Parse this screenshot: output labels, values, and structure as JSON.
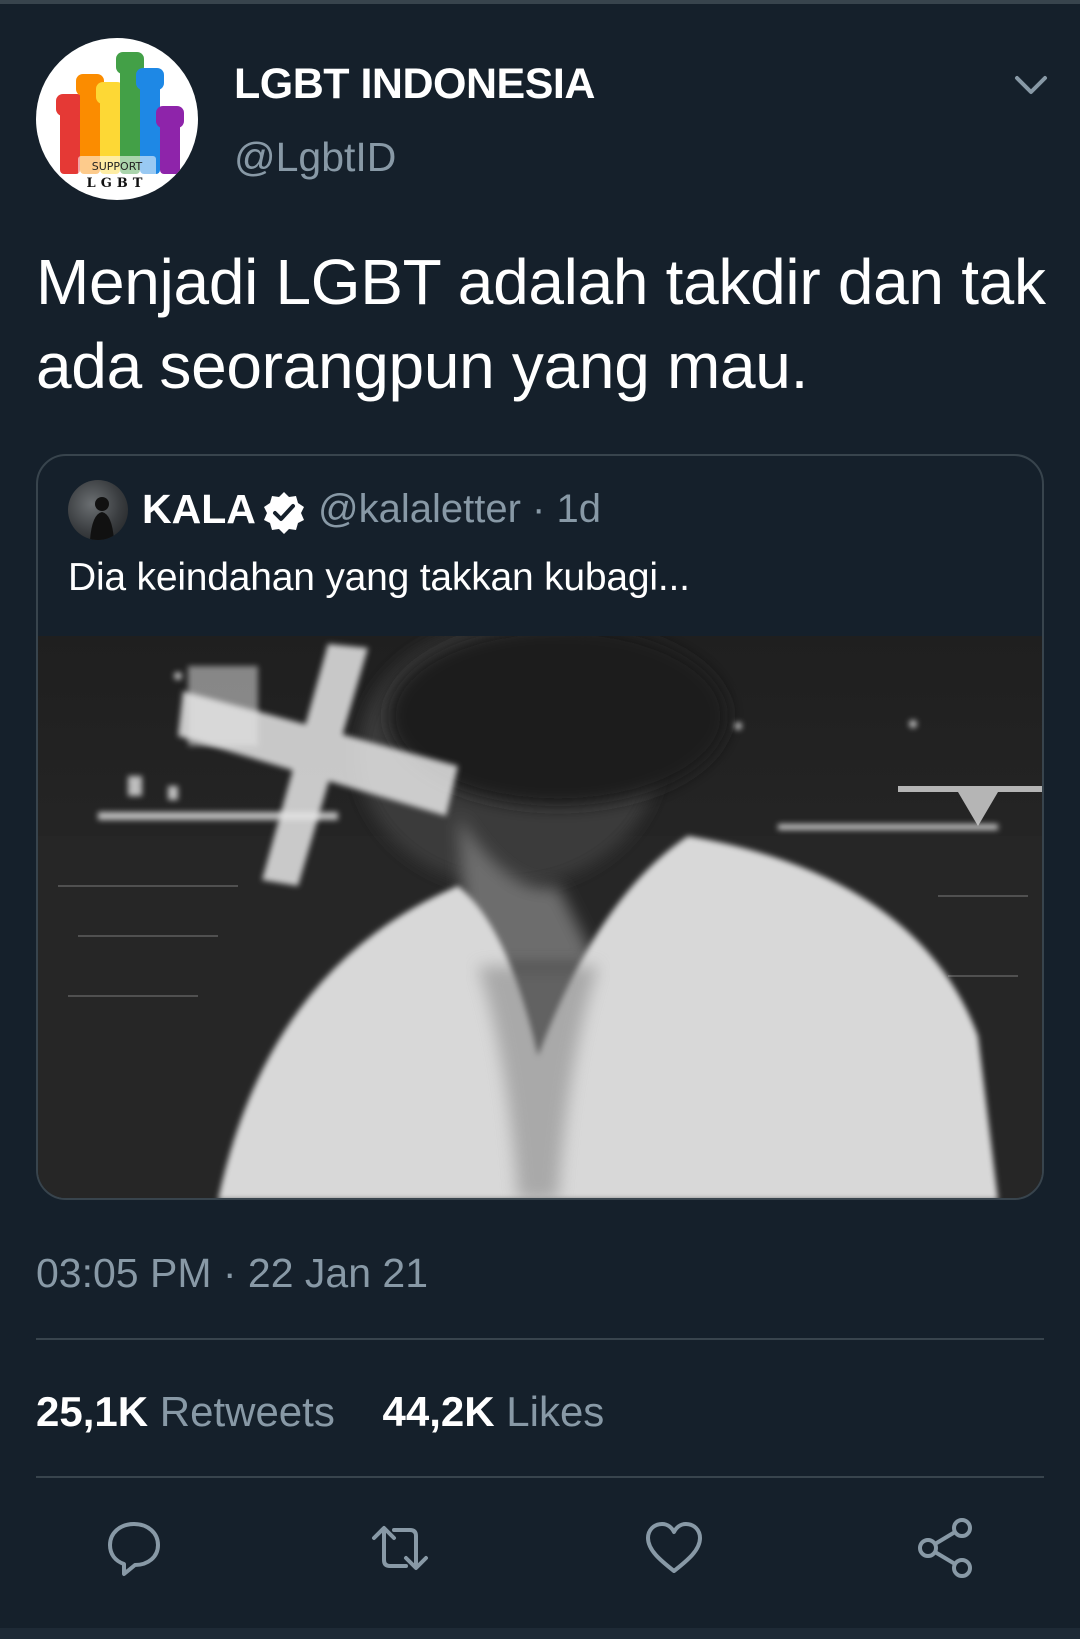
{
  "author": {
    "display_name": "LGBT INDONESIA",
    "handle": "@LgbtID",
    "avatar_text_top": "SUPPORT",
    "avatar_text_bottom": "LGBT"
  },
  "tweet": {
    "text": "Menjadi LGBT adalah takdir dan tak ada seorangpun yang mau."
  },
  "quoted": {
    "name": "KALA",
    "handle_time": "@kalaletter · 1d",
    "text": "Dia keindahan yang takkan kubagi..."
  },
  "meta": {
    "timestamp": "03:05 PM · 22 Jan 21"
  },
  "stats": {
    "retweets_count": "25,1K",
    "retweets_label": "Retweets",
    "likes_count": "44,2K",
    "likes_label": "Likes"
  },
  "icons": {
    "reply": "reply-icon",
    "retweet": "retweet-icon",
    "like": "like-icon",
    "share": "share-icon",
    "caret": "chevron-down-icon",
    "verified": "verified-badge-icon"
  },
  "colors": {
    "background": "#15202b",
    "border": "#38444d",
    "secondary_text": "#8899a6"
  }
}
